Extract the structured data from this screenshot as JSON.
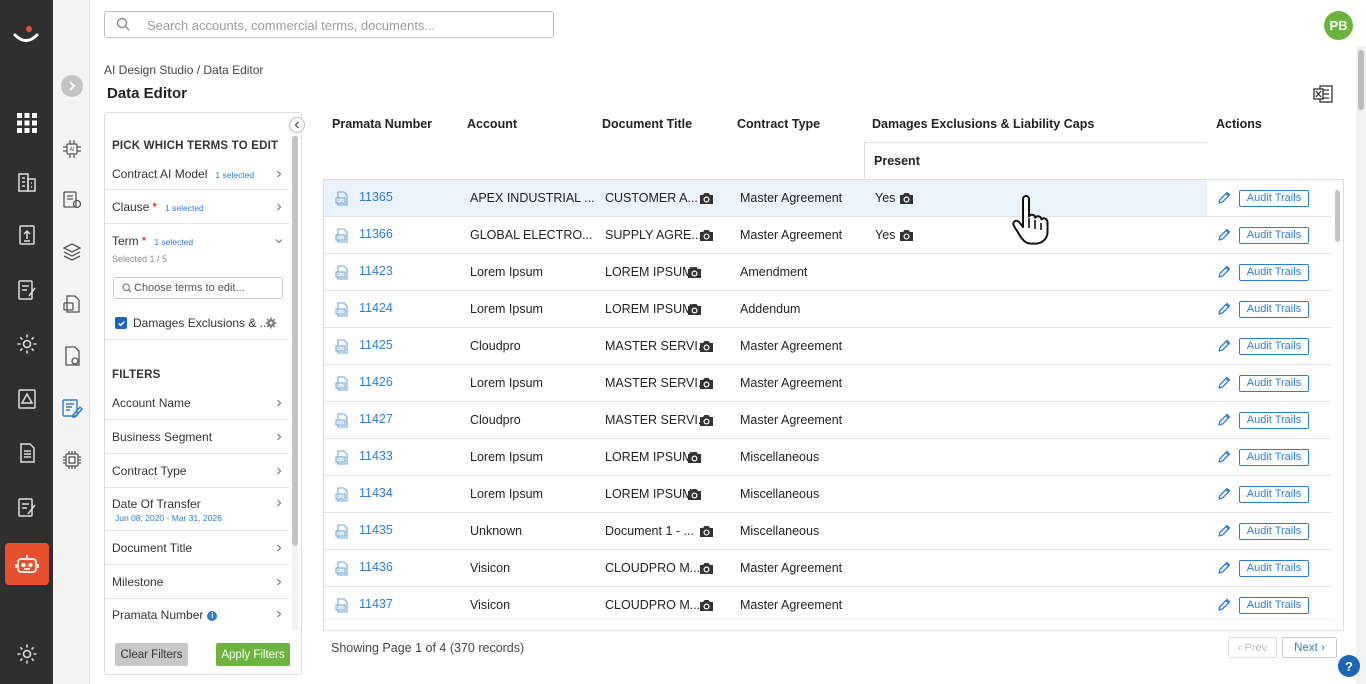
{
  "search": {
    "placeholder": "Search accounts, commercial terms, documents..."
  },
  "user": {
    "initials": "PB"
  },
  "breadcrumb": "AI Design Studio / Data Editor",
  "page_title": "Data Editor",
  "panel": {
    "pick_title": "PICK WHICH TERMS TO EDIT",
    "items": [
      {
        "label": "Contract AI Model",
        "selected": "1 selected",
        "required": false
      },
      {
        "label": "Clause",
        "selected": "1 selected",
        "required": true
      },
      {
        "label": "Term",
        "selected": "1 selected",
        "required": true,
        "sub": "Selected 1 / 5"
      }
    ],
    "term_search_placeholder": "Choose terms to edit...",
    "term_checked_label": "Damages Exclusions & ...",
    "filters_title": "FILTERS",
    "filters": [
      {
        "label": "Account Name"
      },
      {
        "label": "Business Segment"
      },
      {
        "label": "Contract Type"
      },
      {
        "label": "Date Of Transfer",
        "sub": "Jun 08, 2020 - Mar 31, 2026"
      },
      {
        "label": "Document Title"
      },
      {
        "label": "Milestone"
      },
      {
        "label": "Pramata Number",
        "info": "i"
      }
    ],
    "clear_label": "Clear Filters",
    "apply_label": "Apply Filters"
  },
  "table": {
    "columns": {
      "number": "Pramata Number",
      "account": "Account",
      "title": "Document Title",
      "type": "Contract Type",
      "damages": "Damages Exclusions & Liability Caps",
      "present": "Present",
      "actions": "Actions"
    },
    "audit_label": "Audit Trails",
    "rows": [
      {
        "number": "11365",
        "account": "APEX INDUSTRIAL ...",
        "title": "CUSTOMER A...",
        "type": "Master Agreement",
        "present": "Yes",
        "highlight": true
      },
      {
        "number": "11366",
        "account": "GLOBAL ELECTRO...",
        "title": "SUPPLY AGRE...",
        "type": "Master Agreement",
        "present": "Yes"
      },
      {
        "number": "11423",
        "account": "Lorem Ipsum",
        "title": "LOREM IPSUM",
        "type": "Amendment",
        "present": ""
      },
      {
        "number": "11424",
        "account": "Lorem Ipsum",
        "title": "LOREM IPSUM",
        "type": "Addendum",
        "present": ""
      },
      {
        "number": "11425",
        "account": "Cloudpro",
        "title": "MASTER SERVI...",
        "type": "Master Agreement",
        "present": ""
      },
      {
        "number": "11426",
        "account": "Lorem Ipsum",
        "title": "MASTER SERVI...",
        "type": "Master Agreement",
        "present": ""
      },
      {
        "number": "11427",
        "account": "Cloudpro",
        "title": "MASTER SERVI...",
        "type": "Master Agreement",
        "present": ""
      },
      {
        "number": "11433",
        "account": "Lorem Ipsum",
        "title": "LOREM IPSUM",
        "type": "Miscellaneous",
        "present": ""
      },
      {
        "number": "11434",
        "account": "Lorem Ipsum",
        "title": "LOREM IPSUM",
        "type": "Miscellaneous",
        "present": ""
      },
      {
        "number": "11435",
        "account": "Unknown",
        "title": "Document 1 - ...",
        "type": "Miscellaneous",
        "present": ""
      },
      {
        "number": "11436",
        "account": "Visicon",
        "title": "CLOUDPRO M...",
        "type": "Master Agreement",
        "present": ""
      },
      {
        "number": "11437",
        "account": "Visicon",
        "title": "CLOUDPRO M...",
        "type": "Master Agreement",
        "present": ""
      }
    ]
  },
  "footer": {
    "showing": "Showing Page 1 of 4 (370 records)",
    "prev": "‹ Prev",
    "next": "Next ›"
  },
  "help": "?",
  "colors": {
    "accent": "#2a7fd0",
    "brand": "#e8502e",
    "green": "#6db33f",
    "rail": "#2f2f2f"
  }
}
